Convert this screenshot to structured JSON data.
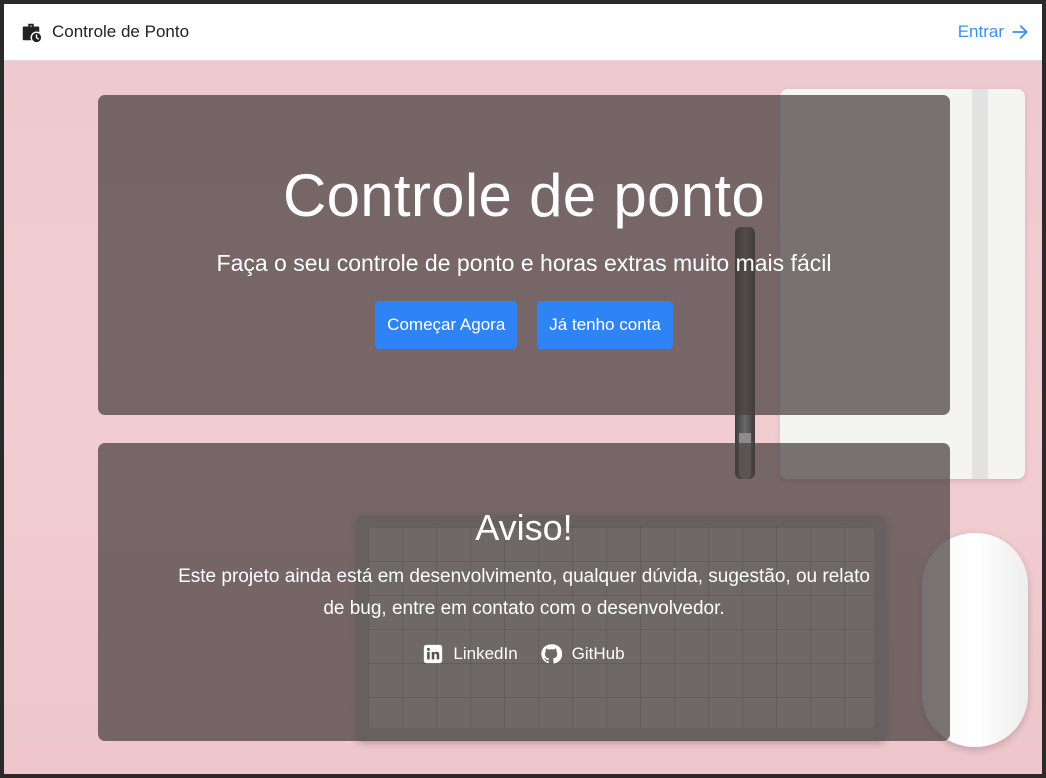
{
  "navbar": {
    "brand": "Controle de Ponto",
    "login_label": "Entrar"
  },
  "hero": {
    "title": "Controle de ponto",
    "subtitle": "Faça o seu controle de ponto e horas extras muito mais fácil",
    "start_button": "Começar Agora",
    "account_button": "Já tenho conta"
  },
  "notice": {
    "title": "Aviso!",
    "message": "Este projeto ainda está em desenvolvimento, qualquer dúvida, sugestão, ou relato de bug, entre em contato com o desenvolvedor.",
    "links": [
      {
        "label": "LinkedIn",
        "icon": "linkedin-icon"
      },
      {
        "label": "GitHub",
        "icon": "github-icon"
      }
    ]
  },
  "colors": {
    "accent": "#2f84f5",
    "link": "#3d8fe8"
  }
}
